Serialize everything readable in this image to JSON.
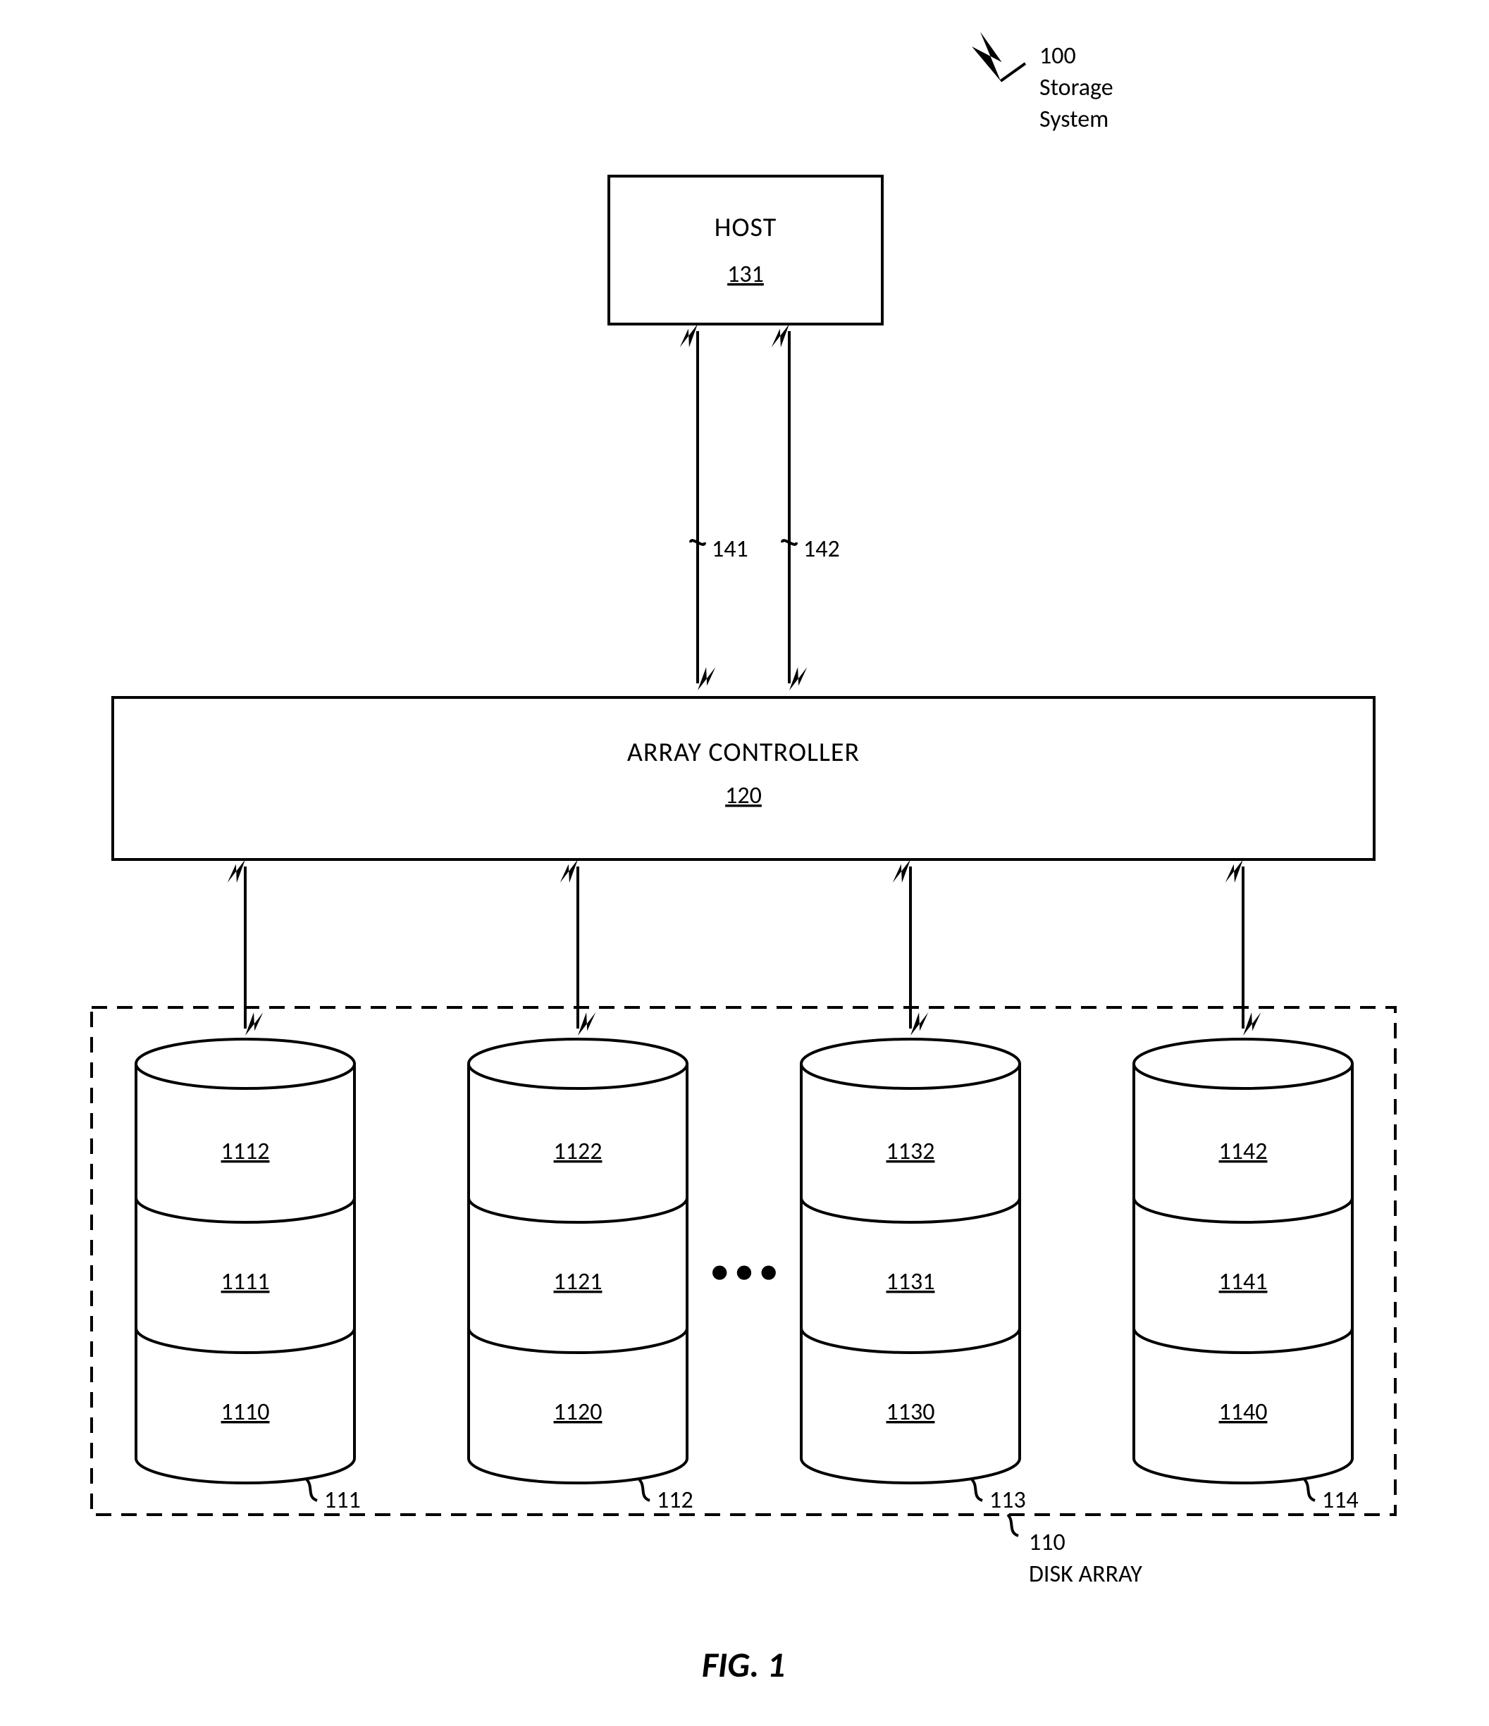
{
  "annotation_ref": "100",
  "annotation_line1": "Storage",
  "annotation_line2": "System",
  "host_label": "HOST",
  "host_ref": "131",
  "link_left_ref": "141",
  "link_right_ref": "142",
  "controller_label": "ARRAY CONTROLLER",
  "controller_ref": "120",
  "disk_array_ref": "110",
  "disk_array_label": "DISK ARRAY",
  "ellipsis": "• • •",
  "disks": [
    {
      "ref": "111",
      "segments": [
        "1112",
        "1111",
        "1110"
      ]
    },
    {
      "ref": "112",
      "segments": [
        "1122",
        "1121",
        "1120"
      ]
    },
    {
      "ref": "113",
      "segments": [
        "1132",
        "1131",
        "1130"
      ]
    },
    {
      "ref": "114",
      "segments": [
        "1142",
        "1141",
        "1140"
      ]
    }
  ]
}
